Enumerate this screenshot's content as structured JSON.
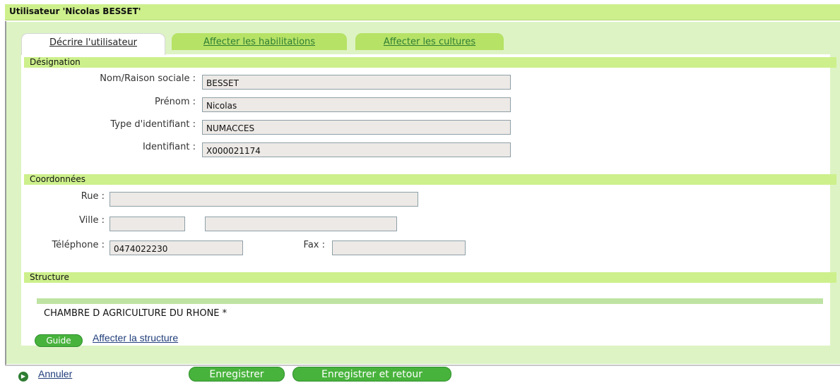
{
  "window": {
    "title": "Utilisateur 'Nicolas BESSET'"
  },
  "tabs": [
    {
      "label": "Décrire l'utilisateur",
      "active": true
    },
    {
      "label": "Affecter les habilitations",
      "active": false
    },
    {
      "label": "Affecter les cultures",
      "active": false
    }
  ],
  "designation": {
    "header": "Désignation",
    "nom_label": "Nom/Raison sociale :",
    "nom_value": "BESSET",
    "prenom_label": "Prénom :",
    "prenom_value": "Nicolas",
    "type_label": "Type d'identifiant :",
    "type_value": "NUMACCES",
    "id_label": "Identifiant :",
    "id_value": "X000021174"
  },
  "coordonnees": {
    "header": "Coordonnées",
    "rue_label": "Rue :",
    "rue_value": "",
    "ville_label": "Ville :",
    "ville_cp_value": "",
    "ville_value": "",
    "tel_label": "Téléphone :",
    "tel_value": "0474022230",
    "fax_label": "Fax :",
    "fax_value": ""
  },
  "structure": {
    "header": "Structure",
    "name": "CHAMBRE D AGRICULTURE DU RHONE *",
    "guide_label": "Guide",
    "affect_label": "Affecter la structure"
  },
  "footer": {
    "cancel_label": "Annuler",
    "save_label": "Enregistrer",
    "save_return_label": "Enregistrer et retour"
  },
  "colors": {
    "accent_light": "#cdf08c",
    "panel_bg": "#ddf3c4",
    "button_green": "#48b33c",
    "link_blue": "#1f3d7a"
  }
}
